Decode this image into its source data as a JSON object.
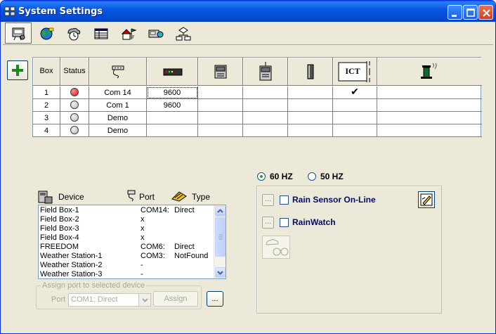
{
  "window": {
    "title": "System Settings"
  },
  "toolbar": {
    "tools": [
      {
        "icon": "serial-port-icon"
      },
      {
        "icon": "globe-icon"
      },
      {
        "icon": "weather-clock-icon"
      },
      {
        "icon": "table-icon"
      },
      {
        "icon": "house-flags-icon"
      },
      {
        "icon": "controller-icon"
      },
      {
        "icon": "flowchart-icon"
      }
    ]
  },
  "grid": {
    "headers": {
      "box": "Box",
      "status": "Status",
      "ict_label": "ICT"
    },
    "header_icons": [
      "serial-cable-icon",
      "modem-icon",
      "radio-box-icon",
      "field-box-icon",
      "cylinder-icon",
      "ict-icon",
      "wireless-sensor-icon"
    ],
    "rows": [
      {
        "box": "1",
        "status": "red",
        "port": "Com 14",
        "baud": "9600",
        "ict_check": "✔"
      },
      {
        "box": "2",
        "status": "gray",
        "port": "Com 1",
        "baud": "9600",
        "ict_check": ""
      },
      {
        "box": "3",
        "status": "gray",
        "port": "Demo",
        "baud": "",
        "ict_check": ""
      },
      {
        "box": "4",
        "status": "gray",
        "port": "Demo",
        "baud": "",
        "ict_check": ""
      }
    ]
  },
  "frequency": {
    "option1": "60 HZ",
    "option2": "50 HZ",
    "selected": "60 HZ"
  },
  "devices": {
    "header": {
      "device": "Device",
      "port": "Port",
      "type": "Type"
    },
    "items": [
      {
        "name": "Field Box-1",
        "port": "COM14:",
        "type": "Direct"
      },
      {
        "name": "Field Box-2",
        "port": "x",
        "type": ""
      },
      {
        "name": "Field Box-3",
        "port": "x",
        "type": ""
      },
      {
        "name": "Field Box-4",
        "port": "x",
        "type": ""
      },
      {
        "name": "FREEDOM",
        "port": "COM6:",
        "type": "Direct"
      },
      {
        "name": "Weather Station-1",
        "port": "COM3:",
        "type": "NotFound"
      },
      {
        "name": "Weather Station-2",
        "port": "-",
        "type": ""
      },
      {
        "name": "Weather Station-3",
        "port": "-",
        "type": ""
      }
    ]
  },
  "assign": {
    "group_label": "Assign port to selected device",
    "port_label": "Port",
    "port_value": "COM1: Direct",
    "assign_label": "Assign",
    "more_label": "..."
  },
  "rain": {
    "more_label": "...",
    "sensor_label": "Rain Sensor On-Line",
    "rainwatch_label": "RainWatch"
  },
  "colors": {
    "status_red": "#e01010",
    "status_gray": "#b8b8b8",
    "title_blue": "#0458dc",
    "label_navy": "#000c65"
  }
}
